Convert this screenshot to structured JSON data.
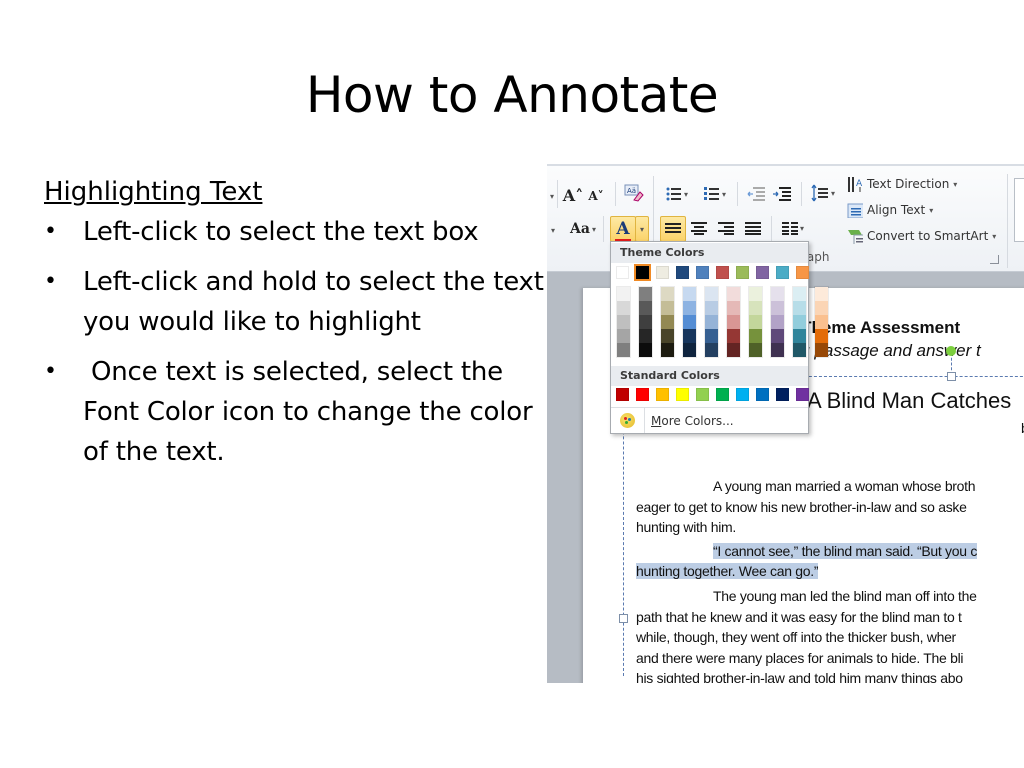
{
  "slide": {
    "title": "How to Annotate",
    "heading": "Highlighting Text",
    "bullets": [
      "Left-click to select the text box",
      "Left-click and hold to select the text you would like to highlight",
      "Once text is selected, select the Font Color icon to change the color of the text."
    ]
  },
  "screenshot": {
    "ribbon": {
      "grow_font_icon": "A˄",
      "shrink_font_icon": "A˅",
      "change_case_label": "Aa",
      "font_color_label": "A",
      "font_color_current": "#e31b1b",
      "text_direction_label": "Text Direction",
      "align_text_label": "Align Text",
      "convert_smartart_label": "Convert to SmartArt",
      "group_label": "agraph"
    },
    "palette": {
      "theme_label": "Theme Colors",
      "standard_label": "Standard Colors",
      "more_colors_accel": "M",
      "more_colors_rest": "ore Colors...",
      "theme_colors": [
        "#ffffff",
        "#000000",
        "#eeece1",
        "#1f497d",
        "#4f81bd",
        "#c0504d",
        "#9bbb59",
        "#8064a2",
        "#4bacc6",
        "#f79646"
      ],
      "selected_theme_index": 1,
      "shades": [
        [
          "#f2f2f2",
          "#d8d8d8",
          "#bfbfbf",
          "#a5a5a5",
          "#7f7f7f"
        ],
        [
          "#7f7f7f",
          "#595959",
          "#3f3f3f",
          "#262626",
          "#0c0c0c"
        ],
        [
          "#ddd9c3",
          "#c4bd97",
          "#938953",
          "#494429",
          "#1d1b10"
        ],
        [
          "#c6d9f0",
          "#8db3e2",
          "#548dd4",
          "#17365d",
          "#0f243e"
        ],
        [
          "#dbe5f1",
          "#b8cce4",
          "#95b3d7",
          "#366092",
          "#244061"
        ],
        [
          "#f2dcdb",
          "#e5b9b7",
          "#d99694",
          "#953734",
          "#632423"
        ],
        [
          "#ebf1dd",
          "#d7e3bc",
          "#c3d69b",
          "#76923c",
          "#4f6128"
        ],
        [
          "#e5e0ec",
          "#ccc1d9",
          "#b2a2c7",
          "#5f497a",
          "#3f3151"
        ],
        [
          "#dbeef3",
          "#b7dde8",
          "#92cddc",
          "#31859b",
          "#205867"
        ],
        [
          "#fdeada",
          "#fbd5b5",
          "#fac08f",
          "#e36c09",
          "#974806"
        ]
      ],
      "standard_colors": [
        "#c00000",
        "#ff0000",
        "#ffc000",
        "#ffff00",
        "#92d050",
        "#00b050",
        "#00b0f0",
        "#0070c0",
        "#002060",
        "#7030a0"
      ]
    },
    "document": {
      "title_fragment": "d Theme Assessment",
      "subtitle_fragment": "ing passage and answer t",
      "story_title_fragment": "A Blind Man Catches",
      "byline_fragment": "b",
      "lines": [
        {
          "text": "A young  man married a woman whose broth",
          "indent": true,
          "highlight": false
        },
        {
          "text": "eager to get to know his new brother-in-law and so aske",
          "indent": false,
          "highlight": false
        },
        {
          "text": "hunting with him.",
          "indent": false,
          "highlight": false
        },
        {
          "text": "“I cannot see,” the blind man said.  “But you c",
          "indent": true,
          "highlight": true
        },
        {
          "text": "hunting together.  Wee can go.”",
          "indent": false,
          "highlight": true
        },
        {
          "text": "The young man led the blind man off into the",
          "indent": true,
          "highlight": false
        },
        {
          "text": "path that he knew and it was easy for the blind man to t",
          "indent": false,
          "highlight": false
        },
        {
          "text": "while, though, they went off into the thicker bush, wher",
          "indent": false,
          "highlight": false
        },
        {
          "text": "and there were many places for animals to hide.  The bli",
          "indent": false,
          "highlight": false
        },
        {
          "text": "his sighted brother-in-law and told him many things abo",
          "indent": false,
          "highlight": false
        }
      ]
    }
  }
}
